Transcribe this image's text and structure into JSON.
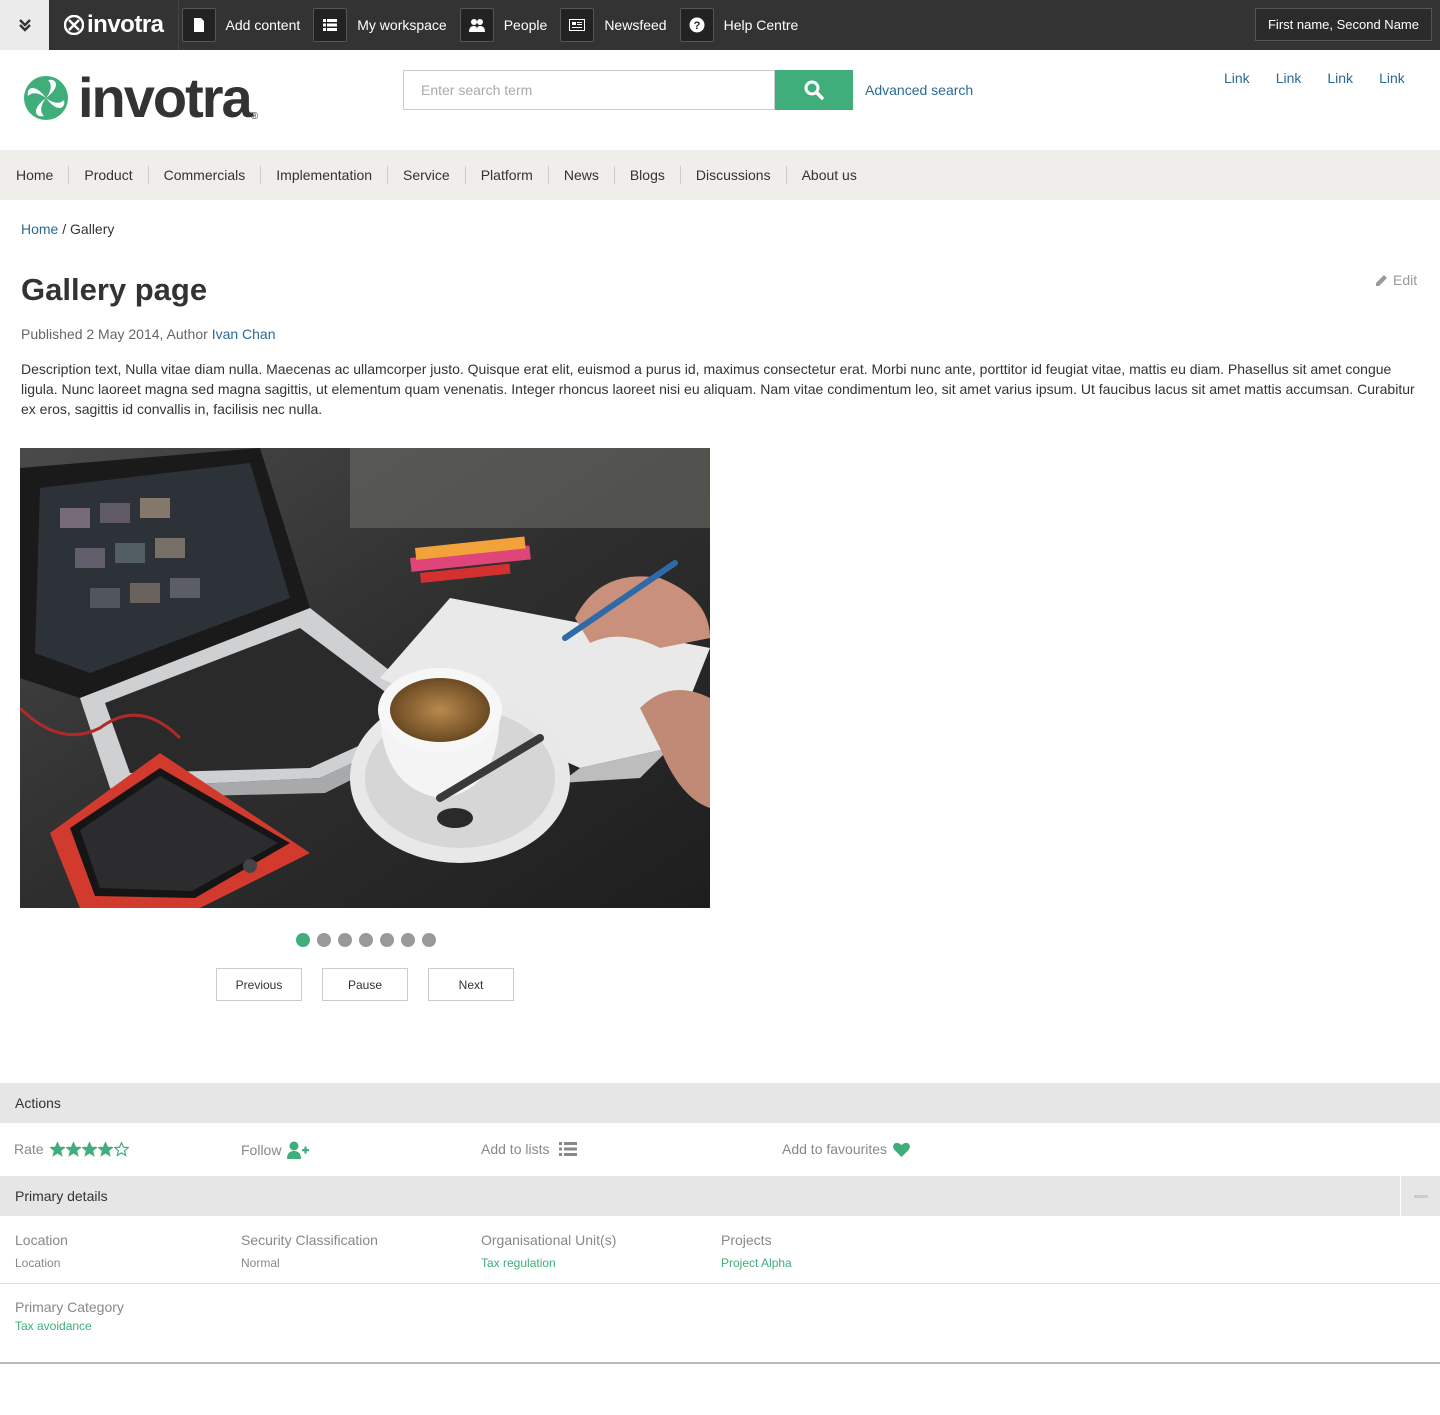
{
  "topbar": {
    "brand": "invotra",
    "items": [
      {
        "label": "Add content",
        "icon": "document-icon"
      },
      {
        "label": "My workspace",
        "icon": "list-icon"
      },
      {
        "label": "People",
        "icon": "people-icon"
      },
      {
        "label": "Newsfeed",
        "icon": "newspaper-icon"
      },
      {
        "label": "Help Centre",
        "icon": "question-icon"
      }
    ],
    "user": "First name, Second Name"
  },
  "header": {
    "brand": "invotra",
    "brand_mark": "®",
    "search_placeholder": "Enter search term",
    "advanced_search": "Advanced search",
    "links": [
      "Link",
      "Link",
      "Link",
      "Link"
    ]
  },
  "nav": [
    "Home",
    "Product",
    "Commercials",
    "Implementation",
    "Service",
    "Platform",
    "News",
    "Blogs",
    "Discussions",
    "About us"
  ],
  "breadcrumb": {
    "home": "Home",
    "current": "/ Gallery"
  },
  "page": {
    "title": "Gallery page",
    "edit": "Edit",
    "published_prefix": "Published 2 May 2014, Author ",
    "author": "Ivan Chan",
    "description": "Description text, Nulla vitae diam nulla. Maecenas ac ullamcorper justo. Quisque erat elit, euismod a purus id, maximus consectetur erat. Morbi nunc ante, porttitor id feugiat vitae, mattis eu diam. Phasellus sit amet congue ligula. Nunc laoreet magna sed magna sagittis, ut elementum quam venenatis. Integer rhoncus laoreet nisi eu aliquam. Nam vitae condimentum leo, sit amet varius ipsum. Ut faucibus lacus sit amet mattis accumsan. Curabitur ex eros, sagittis id convallis in, facilisis nec nulla."
  },
  "gallery": {
    "slide_count": 7,
    "active_slide": 1,
    "previous": "Previous",
    "pause": "Pause",
    "next": "Next"
  },
  "actions": {
    "header": "Actions",
    "rate": "Rate",
    "rating": 4,
    "rating_max": 5,
    "follow": "Follow",
    "add_to_lists": "Add to lists",
    "add_to_favourites": "Add to favourites"
  },
  "details": {
    "header": "Primary details",
    "location_label": "Location",
    "location_value": "Location",
    "security_label": "Security Classification",
    "security_value": "Normal",
    "org_label": "Organisational Unit(s)",
    "org_value": "Tax regulation",
    "projects_label": "Projects",
    "projects_value": "Project Alpha",
    "category_label": "Primary Category",
    "category_value": "Tax avoidance"
  },
  "colors": {
    "accent": "#3fae7a",
    "link": "#2a6a96",
    "topbar": "#333333",
    "nav_bg": "#efeeea"
  }
}
